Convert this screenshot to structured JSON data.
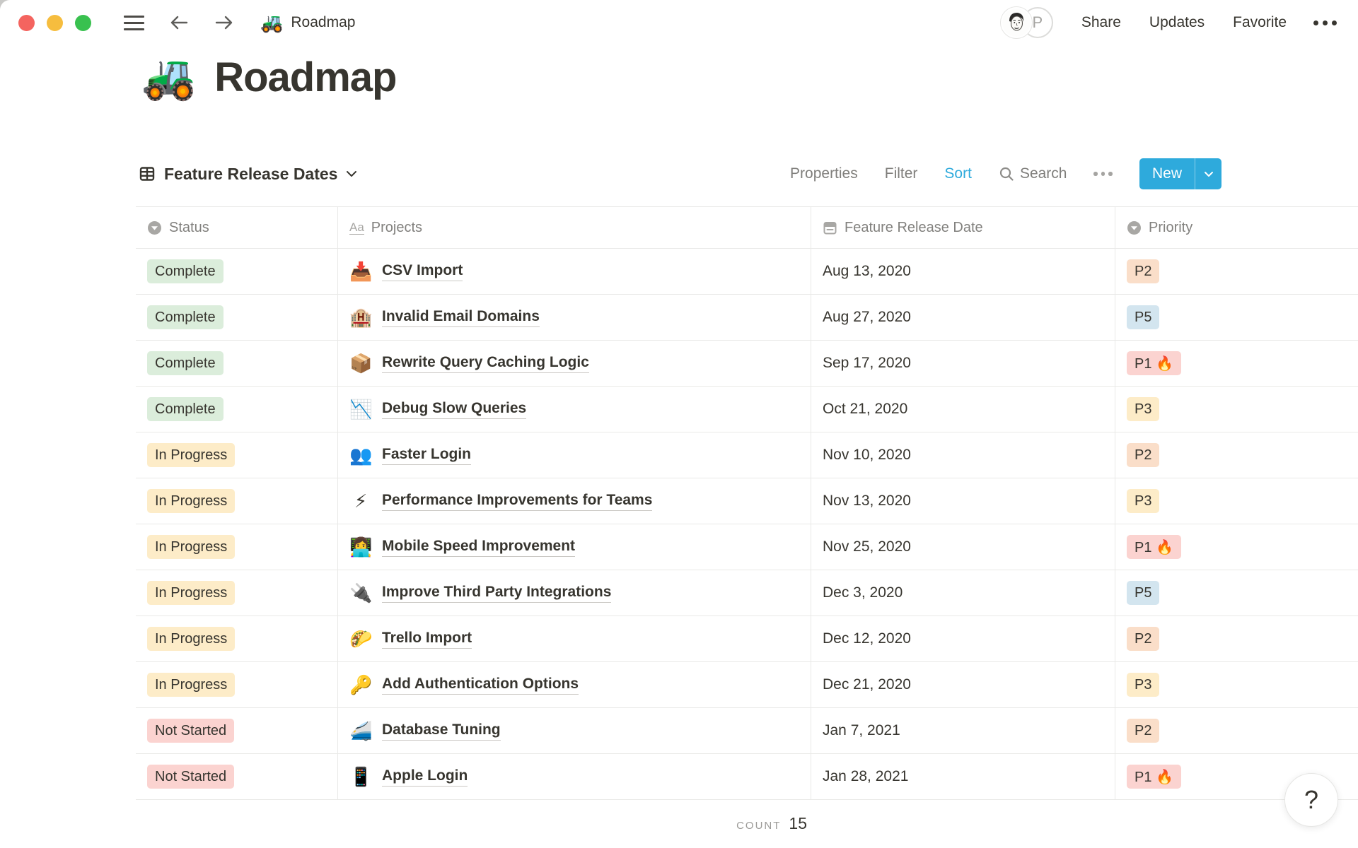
{
  "topbar": {
    "window_controls": [
      "close",
      "minimize",
      "zoom"
    ],
    "breadcrumb_emoji": "🚜",
    "breadcrumb_title": "Roadmap",
    "avatar_letter": "P",
    "share": "Share",
    "updates": "Updates",
    "favorite": "Favorite"
  },
  "page": {
    "emoji": "🚜",
    "title": "Roadmap"
  },
  "view_bar": {
    "view_name": "Feature Release Dates",
    "properties": "Properties",
    "filter": "Filter",
    "sort": "Sort",
    "search": "Search",
    "new": "New"
  },
  "table": {
    "columns": [
      {
        "label": "Status",
        "icon": "select-property-icon"
      },
      {
        "label": "Projects",
        "icon": "title-property-icon"
      },
      {
        "label": "Feature Release Date",
        "icon": "date-property-icon"
      },
      {
        "label": "Priority",
        "icon": "select-property-icon"
      }
    ],
    "rows": [
      {
        "status": "Complete",
        "status_tone": "green",
        "emoji": "📥",
        "project": "CSV Import",
        "date": "Aug 13, 2020",
        "priority": "P2",
        "priority_tone": "orange"
      },
      {
        "status": "Complete",
        "status_tone": "green",
        "emoji": "🏨",
        "project": "Invalid Email Domains",
        "date": "Aug 27, 2020",
        "priority": "P5",
        "priority_tone": "blue"
      },
      {
        "status": "Complete",
        "status_tone": "green",
        "emoji": "📦",
        "project": "Rewrite Query Caching Logic",
        "date": "Sep 17, 2020",
        "priority": "P1 🔥",
        "priority_tone": "red"
      },
      {
        "status": "Complete",
        "status_tone": "green",
        "emoji": "📉",
        "project": "Debug Slow Queries",
        "date": "Oct 21, 2020",
        "priority": "P3",
        "priority_tone": "yellow"
      },
      {
        "status": "In Progress",
        "status_tone": "yellow",
        "emoji": "👥",
        "project": "Faster Login",
        "date": "Nov 10, 2020",
        "priority": "P2",
        "priority_tone": "orange"
      },
      {
        "status": "In Progress",
        "status_tone": "yellow",
        "emoji": "⚡",
        "project": "Performance Improvements for Teams",
        "date": "Nov 13, 2020",
        "priority": "P3",
        "priority_tone": "yellow"
      },
      {
        "status": "In Progress",
        "status_tone": "yellow",
        "emoji": "👩‍💻",
        "project": "Mobile Speed Improvement",
        "date": "Nov 25, 2020",
        "priority": "P1 🔥",
        "priority_tone": "red"
      },
      {
        "status": "In Progress",
        "status_tone": "yellow",
        "emoji": "🔌",
        "project": "Improve Third Party Integrations",
        "date": "Dec 3, 2020",
        "priority": "P5",
        "priority_tone": "blue"
      },
      {
        "status": "In Progress",
        "status_tone": "yellow",
        "emoji": "🌮",
        "project": "Trello Import",
        "date": "Dec 12, 2020",
        "priority": "P2",
        "priority_tone": "orange"
      },
      {
        "status": "In Progress",
        "status_tone": "yellow",
        "emoji": "🔑",
        "project": "Add Authentication Options",
        "date": "Dec 21, 2020",
        "priority": "P3",
        "priority_tone": "yellow"
      },
      {
        "status": "Not Started",
        "status_tone": "red",
        "emoji": "🚄",
        "project": "Database Tuning",
        "date": "Jan 7, 2021",
        "priority": "P2",
        "priority_tone": "orange"
      },
      {
        "status": "Not Started",
        "status_tone": "red",
        "emoji": "📱",
        "project": "Apple Login",
        "date": "Jan 28, 2021",
        "priority": "P1 🔥",
        "priority_tone": "red"
      }
    ],
    "count_label": "COUNT",
    "count_value": "15"
  },
  "help_button": "?",
  "colors": {
    "accent_blue": "#2EAADC",
    "badge_green": "#DBEDDB",
    "badge_yellow": "#FDECC8",
    "badge_red": "#FBD3D0",
    "badge_orange": "#FADEC9",
    "badge_blue": "#D3E5EF",
    "text_dark": "#37352F",
    "text_gray": "#82817E",
    "border": "#E9E9E7"
  }
}
